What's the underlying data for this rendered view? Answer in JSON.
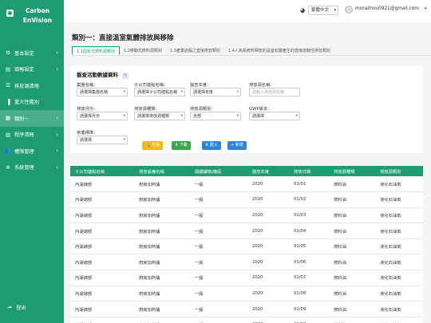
{
  "brand": {
    "line1": "Carbon",
    "line2": "EnVision"
  },
  "sidebar": {
    "items": [
      {
        "icon": "⚙",
        "label": "基本設定",
        "chevron": true
      },
      {
        "icon": "▤",
        "label": "填報設定",
        "chevron": true
      },
      {
        "icon": "☰",
        "label": "排放源清冊",
        "chevron": false
      },
      {
        "icon": "▐",
        "label": "重大性鑑別",
        "chevron": false
      },
      {
        "icon": "▦",
        "label": "類別一",
        "chevron": true
      },
      {
        "icon": "▥",
        "label": "程序清冊",
        "chevron": true
      },
      {
        "icon": "👥",
        "label": "權限管理",
        "chevron": true
      },
      {
        "icon": "✲",
        "label": "系統管理",
        "chevron": true
      }
    ],
    "logout": "登出"
  },
  "topbar": {
    "language": "繁體中文",
    "email": "morazhou0921@gmail.com"
  },
  "page": {
    "title": "類別一：直接溫室氣體排放與移除",
    "tabs": [
      "1.1固定式燃料源類別",
      "1.2移動式燃料源類別",
      "1.3產業過程之直接排放類別",
      "1.4人為系統所釋放的溫室氣體產生的直接逸散性排放類別"
    ]
  },
  "filters": {
    "section_title": "盤查活動數據資料",
    "fields": [
      {
        "label": "集團名稱：",
        "value": "請選擇集團名稱",
        "type": "select"
      },
      {
        "label": "子公司建點名稱：",
        "value": "請選擇子公司建點名稱",
        "type": "select"
      },
      {
        "label": "盤查年度：",
        "value": "請選擇年度",
        "type": "select"
      },
      {
        "label": "排放源名稱：",
        "value": "請輸入排放源名稱",
        "type": "input"
      },
      {
        "label": "排放月份：",
        "value": "請選擇月份",
        "type": "select"
      },
      {
        "label": "排放源種類：",
        "value": "請選擇排放源種類",
        "type": "select"
      },
      {
        "label": "排放源類別：",
        "value": "全部",
        "type": "select"
      },
      {
        "label": "GWP版本：",
        "value": "請選擇",
        "type": "select"
      },
      {
        "label": "依循標準：",
        "value": "請選擇",
        "type": "select"
      }
    ],
    "buttons": {
      "search": "查詢",
      "download": "下載",
      "import": "匯入",
      "add": "新增"
    }
  },
  "table": {
    "headers": [
      "子公司建點名稱",
      "排放設備名稱",
      "開讀讀物/廠區",
      "盤查年度",
      "排放日期",
      "排放源種類",
      "排放源類別"
    ],
    "rows": [
      [
        "內湖總部",
        "廚房加熱爐",
        "一般",
        "2020",
        "01/01",
        "燃料油",
        "液化石油氣"
      ],
      [
        "內湖總部",
        "廚房加熱爐",
        "一般",
        "2020",
        "01/02",
        "燃料油",
        "液化石油氣"
      ],
      [
        "內湖總部",
        "廚房加熱爐",
        "一般",
        "2020",
        "01/03",
        "燃料油",
        "液化石油氣"
      ],
      [
        "內湖總部",
        "廚房加熱爐",
        "一般",
        "2020",
        "01/04",
        "燃料油",
        "液化石油氣"
      ],
      [
        "內湖總部",
        "廚房加熱爐",
        "一般",
        "2020",
        "01/05",
        "燃料油",
        "液化石油氣"
      ],
      [
        "內湖總部",
        "廚房加熱爐",
        "一般",
        "2020",
        "01/06",
        "燃料油",
        "液化石油氣"
      ],
      [
        "內湖總部",
        "廚房加熱爐",
        "一般",
        "2020",
        "01/07",
        "燃料油",
        "液化石油氣"
      ],
      [
        "內湖總部",
        "廚房加熱爐",
        "一般",
        "2020",
        "01/08",
        "燃料油",
        "液化石油氣"
      ],
      [
        "內湖總部",
        "廚房加熱爐",
        "一般",
        "2020",
        "01/09",
        "燃料油",
        "液化石油氣"
      ],
      [
        "內湖總部",
        "廚房加熱爐",
        "一般",
        "2020",
        "01/10",
        "燃料油",
        "液化石油氣"
      ]
    ]
  },
  "colors": {
    "primary": "#1f9b74",
    "search": "#f2b824",
    "download": "#3aa84a",
    "import": "#2f86d6"
  }
}
